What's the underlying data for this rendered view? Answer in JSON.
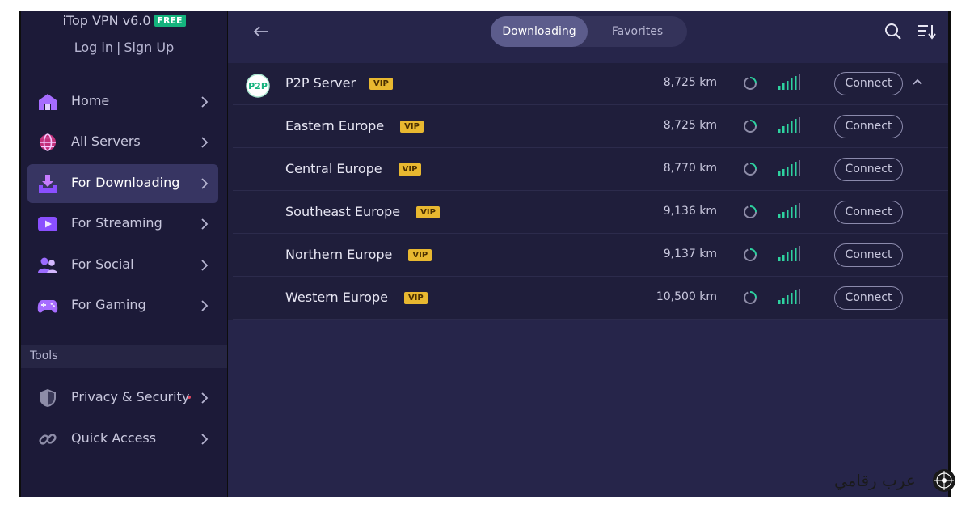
{
  "app": {
    "title": "iTop VPN v6.0",
    "badge": "FREE",
    "login": "Log in",
    "separator": "|",
    "signup": "Sign Up"
  },
  "sidebar": {
    "items": [
      {
        "label": "Home",
        "icon": "home-icon"
      },
      {
        "label": "All Servers",
        "icon": "globe-icon"
      },
      {
        "label": "For Downloading",
        "icon": "download-icon",
        "active": true
      },
      {
        "label": "For Streaming",
        "icon": "play-icon"
      },
      {
        "label": "For Social",
        "icon": "people-icon"
      },
      {
        "label": "For Gaming",
        "icon": "gamepad-icon"
      }
    ],
    "tools_header": "Tools",
    "tools": [
      {
        "label": "Privacy & Security",
        "icon": "shield-icon",
        "notification_dot": true
      },
      {
        "label": "Quick Access",
        "icon": "link-icon"
      }
    ]
  },
  "main": {
    "tabs": [
      {
        "label": "Downloading",
        "active": true
      },
      {
        "label": "Favorites"
      }
    ],
    "vip_label": "VIP",
    "connect_label": "Connect",
    "servers": [
      {
        "name": "P2P Server",
        "distance": "8,725 km",
        "logo": "P2P",
        "expanded": true
      },
      {
        "name": "Eastern Europe",
        "distance": "8,725 km"
      },
      {
        "name": "Central Europe",
        "distance": "8,770 km"
      },
      {
        "name": "Southeast Europe",
        "distance": "9,136 km"
      },
      {
        "name": "Northern Europe",
        "distance": "9,137 km"
      },
      {
        "name": "Western Europe",
        "distance": "10,500 km"
      }
    ]
  },
  "watermark": {
    "text": "عرب رقامي"
  },
  "colors": {
    "sidebar_bg": "#1c1a38",
    "main_bg": "#26254a",
    "accent_green": "#14b37d",
    "vip_gold": "#e8b830",
    "signal_green": "#2ed3a0",
    "icon_purple": "#a66cff"
  }
}
